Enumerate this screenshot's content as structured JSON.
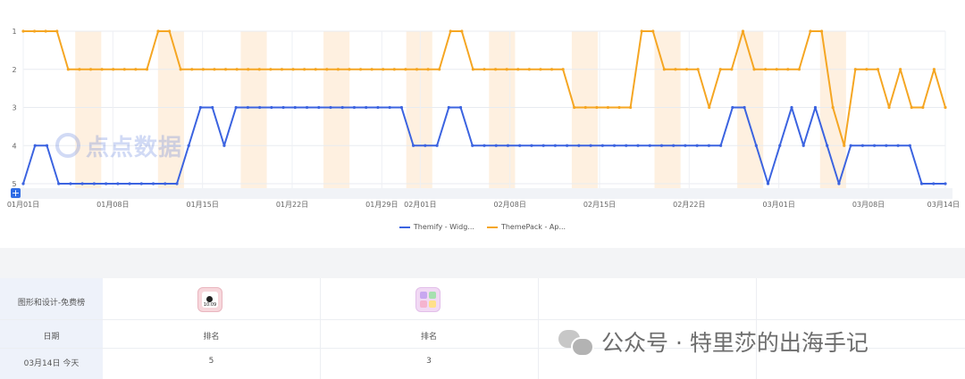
{
  "chart_data": {
    "type": "line",
    "y_ticks": [
      "1",
      "2",
      "3",
      "4",
      "5"
    ],
    "y_reversed": true,
    "ylim": [
      1,
      5
    ],
    "x_tick_labels": [
      "01月01日",
      "01月08日",
      "01月15日",
      "01月22日",
      "01月29日",
      "02月01日",
      "02月08日",
      "02月15日",
      "02月22日",
      "03月01日",
      "03月08日",
      "03月14日"
    ],
    "highlight_days": [
      "01月06日",
      "01月07日",
      "01月13日",
      "01月14日",
      "01月20日",
      "01月21日",
      "01月27日",
      "01月28日",
      "02月03日",
      "02月04日",
      "02月10日",
      "02月11日",
      "02月17日",
      "02月18日",
      "02月24日",
      "02月25日",
      "03月02日",
      "03月03日",
      "03月09日",
      "03月10日"
    ],
    "grid": true,
    "legend_position": "bottom",
    "series": [
      {
        "name": "Themify - Widg...",
        "color": "#3b63e0",
        "values": [
          5,
          4,
          4,
          5,
          5,
          5,
          5,
          5,
          5,
          5,
          5,
          5,
          5,
          5,
          4,
          3,
          3,
          4,
          3,
          3,
          3,
          3,
          3,
          3,
          3,
          3,
          3,
          3,
          3,
          3,
          3,
          3,
          3,
          4,
          4,
          4,
          3,
          3,
          4,
          4,
          4,
          4,
          4,
          4,
          4,
          4,
          4,
          4,
          4,
          4,
          4,
          4,
          4,
          4,
          4,
          4,
          4,
          4,
          4,
          4,
          3,
          3,
          4,
          5,
          4,
          3,
          4,
          3,
          4,
          5,
          4,
          4,
          4,
          4,
          4,
          4,
          5,
          5,
          5
        ]
      },
      {
        "name": "ThemePack - Ap...",
        "color": "#f5a623",
        "values": [
          1,
          1,
          1,
          1,
          2,
          2,
          2,
          2,
          2,
          2,
          2,
          2,
          1,
          1,
          2,
          2,
          2,
          2,
          2,
          2,
          2,
          2,
          2,
          2,
          2,
          2,
          2,
          2,
          2,
          2,
          2,
          2,
          2,
          2,
          2,
          2,
          2,
          2,
          1,
          1,
          2,
          2,
          2,
          2,
          2,
          2,
          2,
          2,
          2,
          3,
          3,
          3,
          3,
          3,
          3,
          1,
          1,
          2,
          2,
          2,
          2,
          3,
          2,
          2,
          1,
          2,
          2,
          2,
          2,
          2,
          1,
          1,
          3,
          4,
          2,
          2,
          2,
          3,
          2,
          3,
          3,
          2,
          3
        ]
      }
    ]
  },
  "table": {
    "header_row_label": "图形和设计-免费榜",
    "col_date_label": "日期",
    "col1_label": "排名",
    "col2_label": "排名",
    "row_date": "03月14日 今天",
    "row_val1": "5",
    "row_val2": "3"
  },
  "icons": {
    "app1_time": "10:09"
  },
  "watermark": {
    "logo_text": "点点数据",
    "footer_text": "公众号 · 特里莎的出海手记"
  },
  "plus_label": "+"
}
